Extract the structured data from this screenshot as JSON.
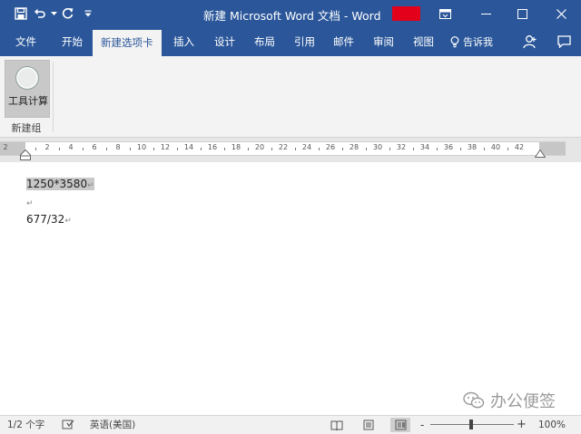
{
  "window": {
    "title": "新建 Microsoft Word 文档  -  Word"
  },
  "quick_access": {
    "icons": [
      "save-icon",
      "undo-icon",
      "dropdown-arrow-icon",
      "redo-icon",
      "customize-icon"
    ]
  },
  "tabs": [
    {
      "label": "文件"
    },
    {
      "label": "开始"
    },
    {
      "label": "新建选项卡"
    },
    {
      "label": "插入"
    },
    {
      "label": "设计"
    },
    {
      "label": "布局"
    },
    {
      "label": "引用"
    },
    {
      "label": "邮件"
    },
    {
      "label": "审阅"
    },
    {
      "label": "视图"
    }
  ],
  "tell_me": {
    "label": "告诉我"
  },
  "ribbon": {
    "tool_button_label": "工具计算",
    "group_label": "新建组"
  },
  "ruler": {
    "numbers": [
      "2",
      "2",
      "4",
      "6",
      "8",
      "10",
      "12",
      "14",
      "16",
      "18",
      "20",
      "22",
      "24",
      "26",
      "28",
      "30",
      "32",
      "34",
      "36",
      "38",
      "40",
      "42"
    ]
  },
  "document": {
    "line1": "1250*3580",
    "line3": "677/32",
    "paragraph_mark": "↵"
  },
  "watermark": {
    "text": "办公便签"
  },
  "status": {
    "page_words": "1/2 个字",
    "language": "英语(美国)",
    "zoom_minus": "-",
    "zoom_plus": "+",
    "zoom_level": "100%"
  },
  "colors": {
    "accent": "#2b579a",
    "title_red_block": "#e2001a"
  }
}
